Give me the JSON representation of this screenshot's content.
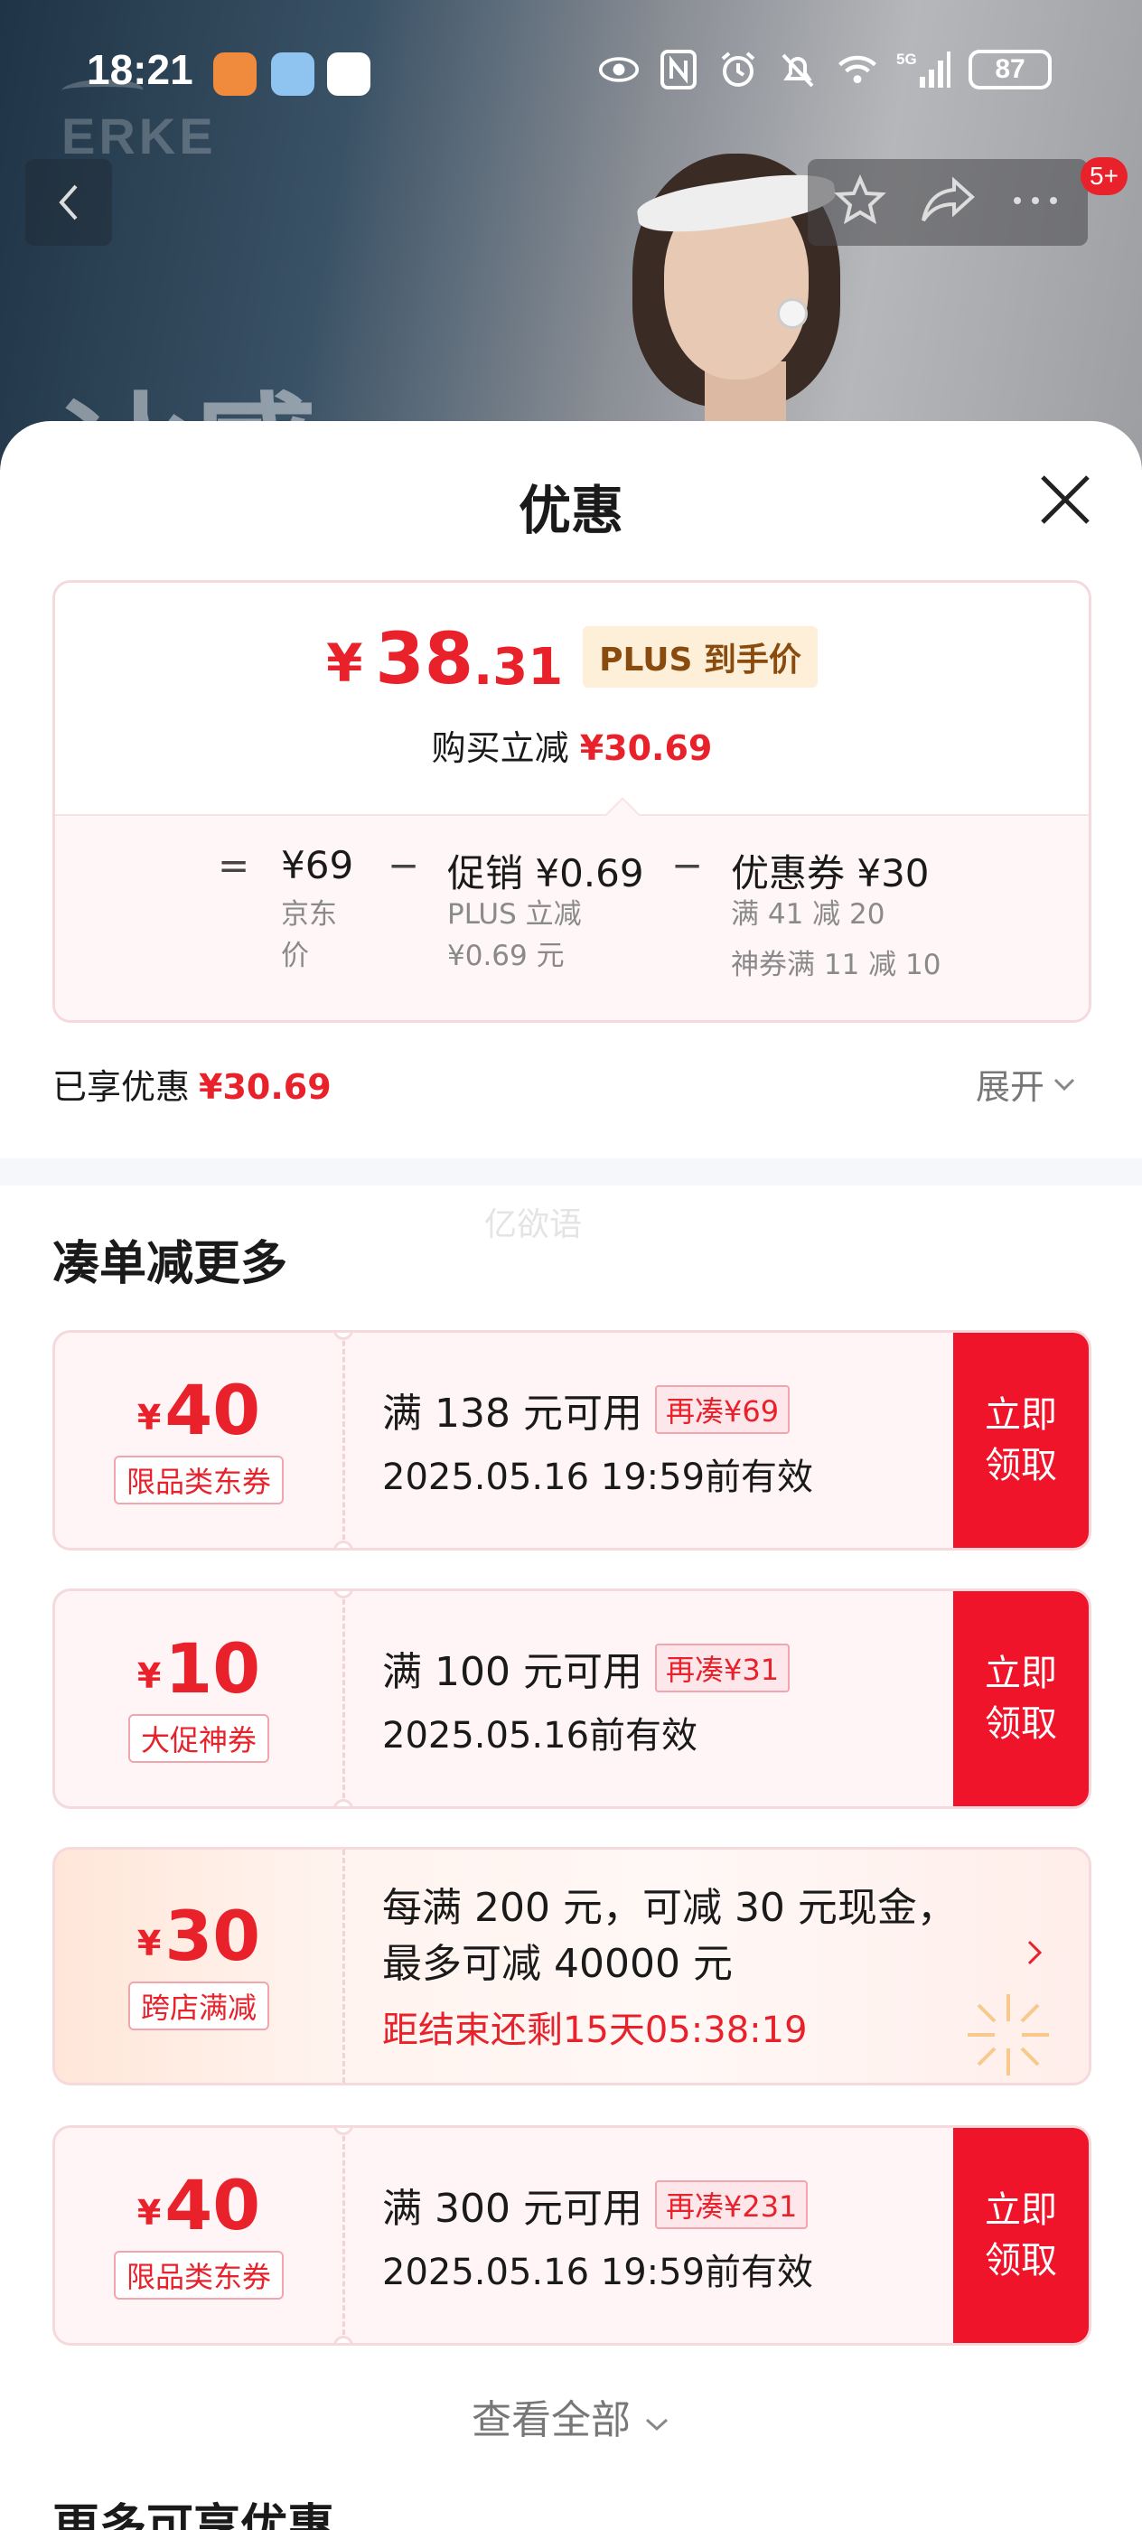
{
  "status_bar": {
    "time": "18:21",
    "battery": "87"
  },
  "banner": {
    "brand": "ERKE",
    "big_text": "冰感"
  },
  "nav": {
    "badge": "5+"
  },
  "sheet": {
    "title": "优惠"
  },
  "price_card": {
    "currency": "¥",
    "price_integer": "38",
    "price_decimal": ".31",
    "plus_tag": "PLUS 到手价",
    "reduce_label": "购买立减",
    "reduce_value": "¥30.69",
    "breakdown": {
      "op_equals": "=",
      "op_minus": "−",
      "jd_price": "¥69",
      "jd_label_line1": "京东",
      "jd_label_line2": "价",
      "promo_main": "促销 ¥0.69",
      "promo_sub1": "PLUS 立减",
      "promo_sub2": "¥0.69 元",
      "coupon_main": "优惠券 ¥30",
      "coupon_sub1": "满 41 减 20",
      "coupon_sub2": "神券满 11 减 10"
    }
  },
  "enjoyed": {
    "label": "已享优惠",
    "value": "¥30.69",
    "expand": "展开"
  },
  "watermark": "亿欲语",
  "section": {
    "title": "凑单减更多"
  },
  "coupons": [
    {
      "currency": "¥",
      "amount": "40",
      "tag": "限品类东券",
      "condition": "满 138 元可用",
      "badge": "再凑¥69",
      "validity": "2025.05.16 19:59前有效",
      "btn_line1": "立即",
      "btn_line2": "领取"
    },
    {
      "currency": "¥",
      "amount": "10",
      "tag": "大促神券",
      "condition": "满 100 元可用",
      "badge": "再凑¥31",
      "validity": "2025.05.16前有效",
      "btn_line1": "立即",
      "btn_line2": "领取"
    },
    {
      "currency": "¥",
      "amount": "30",
      "tag": "跨店满减",
      "line1": "每满 200 元，可减 30 元现金，",
      "line2": "最多可减 40000 元",
      "countdown": "距结束还剩15天05:38:19"
    },
    {
      "currency": "¥",
      "amount": "40",
      "tag": "限品类东券",
      "condition": "满 300 元可用",
      "badge": "再凑¥231",
      "validity": "2025.05.16 19:59前有效",
      "btn_line1": "立即",
      "btn_line2": "领取"
    }
  ],
  "view_all": "查看全部",
  "more_section": {
    "title": "更多可享优惠"
  },
  "colors": {
    "accent_red": "#e8212b",
    "button_red": "#f0142a",
    "plus_gold": "#8a4b0f"
  }
}
